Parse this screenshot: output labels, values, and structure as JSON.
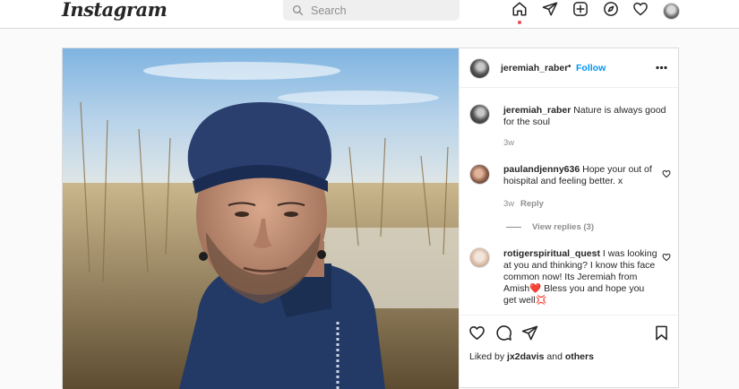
{
  "app": {
    "logo_text": "Instagram"
  },
  "search": {
    "placeholder": "Search",
    "icon": "search-icon"
  },
  "nav": {
    "icons": [
      "home-icon",
      "direct-message-icon",
      "new-post-icon",
      "explore-icon",
      "activity-heart-icon",
      "profile-avatar"
    ],
    "active": "home-icon",
    "active_indicator_color": "#ed4956"
  },
  "post": {
    "author": "jeremiah_raber",
    "separator": "•",
    "follow_label": "Follow",
    "more_icon": "more-options-icon",
    "caption": {
      "username": "jeremiah_raber",
      "text": "Nature is always good for the soul",
      "time": "3w"
    },
    "comments": [
      {
        "username": "paulandjenny636",
        "text": "Hope your out of hoispital and feeling better. x",
        "time": "3w",
        "reply_label": "Reply",
        "view_replies": "View replies (3)"
      },
      {
        "username": "rotigerspiritual_quest",
        "text": "I was looking at you and thinking? I know this face common now! Its Jeremiah from Amish❤️ Bless you and hope you get well💢"
      }
    ],
    "actions": [
      "like-icon",
      "comment-icon",
      "share-icon",
      "save-icon"
    ],
    "liked_by": {
      "prefix": "Liked by",
      "user": "jx2davis",
      "conjunction": "and",
      "others": "others"
    }
  },
  "colors": {
    "accent": "#0095f6",
    "text": "#262626",
    "muted": "#8e8e8e",
    "border": "#dbdbdb"
  }
}
